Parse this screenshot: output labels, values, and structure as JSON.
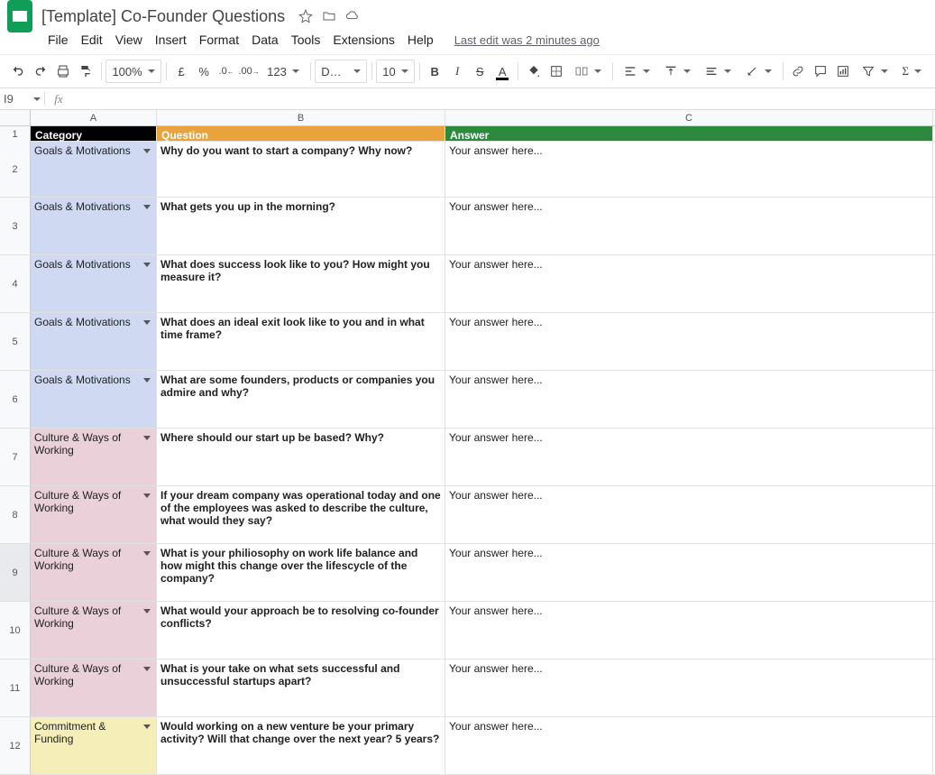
{
  "doc": {
    "title": "[Template] Co-Founder Questions",
    "last_edit": "Last edit was 2 minutes ago"
  },
  "menu": {
    "file": "File",
    "edit": "Edit",
    "view": "View",
    "insert": "Insert",
    "format": "Format",
    "data": "Data",
    "tools": "Tools",
    "extensions": "Extensions",
    "help": "Help"
  },
  "toolbar": {
    "zoom": "100%",
    "currency": "£",
    "percent": "%",
    "dec_dec": ".0",
    "inc_dec": ".00",
    "num_format": "123",
    "font": "Default (Ari...",
    "font_size": "10",
    "letter_a": "A"
  },
  "namebox": "I9",
  "col_headers": {
    "A": "A",
    "B": "B",
    "C": "C"
  },
  "headers": {
    "category": "Category",
    "question": "Question",
    "answer": "Answer"
  },
  "rows": [
    {
      "num": "1"
    },
    {
      "num": "2",
      "cat": "Goals & Motivations",
      "cat_class": "cat-goals",
      "q": "Why do you want to start a company? Why now?",
      "a": "Your answer here..."
    },
    {
      "num": "3",
      "cat": "Goals & Motivations",
      "cat_class": "cat-goals",
      "q": "What gets you up in the morning?",
      "a": "Your answer here..."
    },
    {
      "num": "4",
      "cat": "Goals & Motivations",
      "cat_class": "cat-goals",
      "q": "What does success look like to you? How might you measure it?",
      "a": "Your answer here..."
    },
    {
      "num": "5",
      "cat": "Goals & Motivations",
      "cat_class": "cat-goals",
      "q": "What does an ideal exit look like to you and in what time frame?",
      "a": "Your answer here..."
    },
    {
      "num": "6",
      "cat": "Goals & Motivations",
      "cat_class": "cat-goals",
      "q": "What are some founders, products or companies you admire and why?",
      "a": "Your answer here..."
    },
    {
      "num": "7",
      "cat": "Culture & Ways of Working",
      "cat_class": "cat-culture",
      "q": "Where should our start up be based? Why?",
      "a": "Your answer here..."
    },
    {
      "num": "8",
      "cat": "Culture & Ways of Working",
      "cat_class": "cat-culture",
      "q": "If your dream company was operational today and one of the employees was asked to describe the culture, what would they say?",
      "a": "Your answer here..."
    },
    {
      "num": "9",
      "cat": "Culture & Ways of Working",
      "cat_class": "cat-culture",
      "q": "What is your philiosophy on work life balance and how might this change over the lifescycle of the company?",
      "a": "Your answer here..."
    },
    {
      "num": "10",
      "cat": "Culture & Ways of Working",
      "cat_class": "cat-culture",
      "q": "What would your approach be to resolving co-founder conflicts?",
      "a": "Your answer here..."
    },
    {
      "num": "11",
      "cat": "Culture & Ways of Working",
      "cat_class": "cat-culture",
      "q": "What is your take on what sets successful and unsuccessful startups apart?",
      "a": "Your answer here..."
    },
    {
      "num": "12",
      "cat": "Commitment & Funding",
      "cat_class": "cat-commit",
      "q": "Would working on a new venture be your primary activity? Will that change over the next year? 5 years?",
      "a": "Your answer here..."
    }
  ],
  "colors": {
    "header_category": "#000000",
    "header_question": "#e8a33d",
    "header_answer": "#2b8a3e",
    "cat_goals": "#cfdaf2",
    "cat_culture": "#e9d0d9",
    "cat_commit": "#f5eeb8"
  }
}
